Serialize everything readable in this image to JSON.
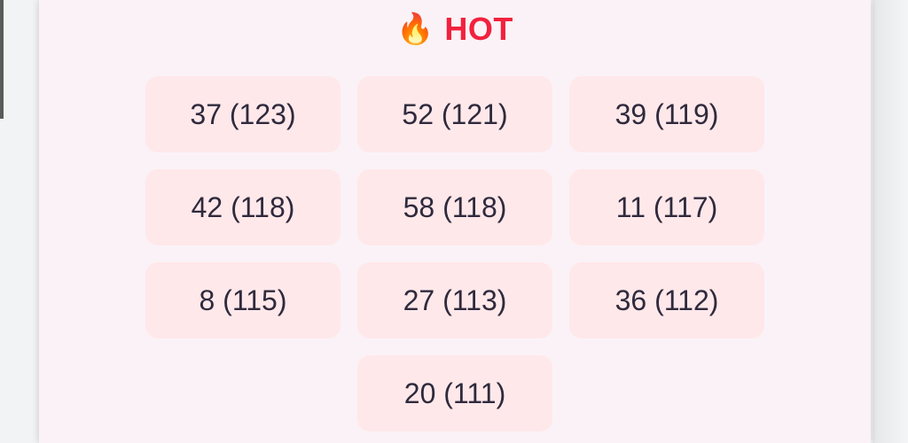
{
  "section": {
    "icon": "fire-icon",
    "icon_glyph": "🔥",
    "title": "HOT",
    "title_color": "#f2213e"
  },
  "chips": [
    {
      "label": "37 (123)"
    },
    {
      "label": "52 (121)"
    },
    {
      "label": "39 (119)"
    },
    {
      "label": "42 (118)"
    },
    {
      "label": "58 (118)"
    },
    {
      "label": "11 (117)"
    },
    {
      "label": "8 (115)"
    },
    {
      "label": "27 (113)"
    },
    {
      "label": "36 (112)"
    },
    {
      "label": "20 (111)"
    }
  ],
  "colors": {
    "panel_bg": "#faf2f6",
    "chip_bg": "#ffe8ea",
    "chip_text": "#2f2a3d"
  }
}
